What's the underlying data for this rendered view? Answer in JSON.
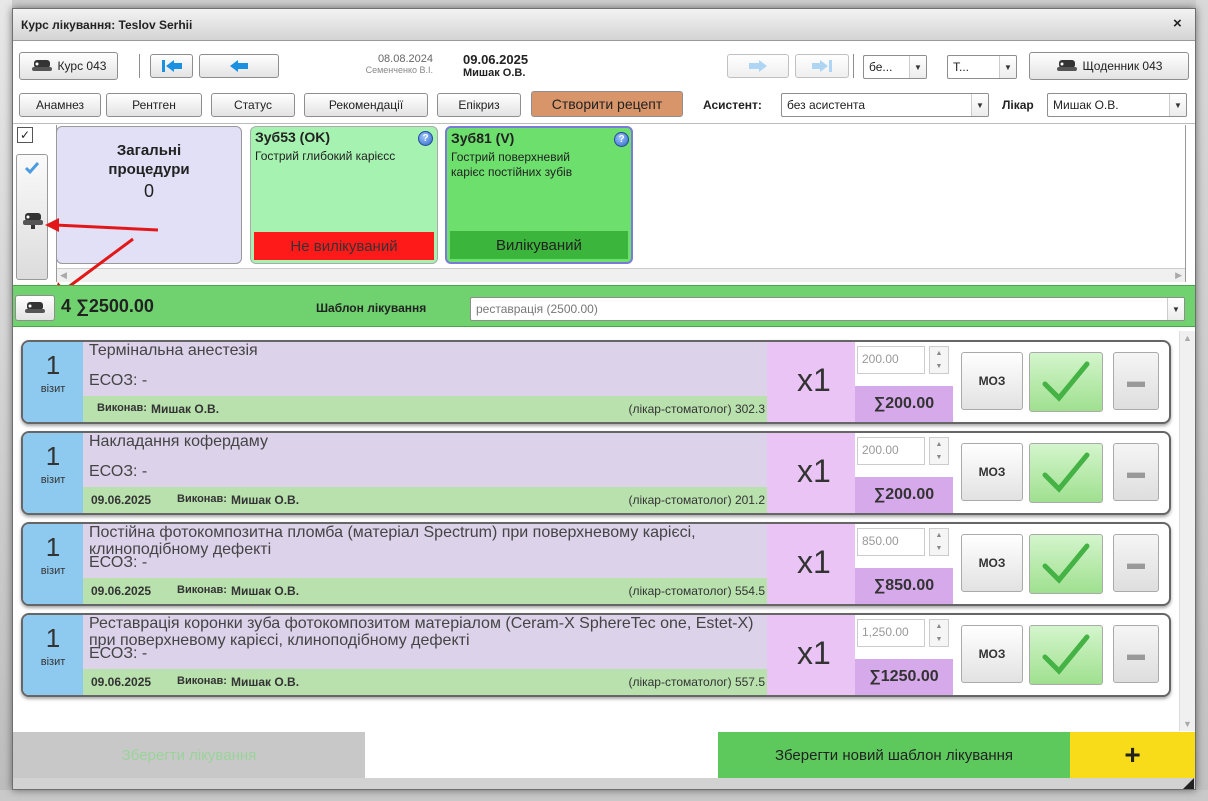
{
  "window": {
    "title": "Курс лікування: Teslov Serhii",
    "close": "×"
  },
  "toolbar": {
    "course_btn": "Курс 043",
    "prev_date": "08.08.2024",
    "prev_doctor": "Семенченко В.І.",
    "cur_date": "09.06.2025",
    "cur_doctor": "Мишак О.В.",
    "dd1": "бе...",
    "dd2": "Т...",
    "diary_btn": "Щоденник 043"
  },
  "nav": {
    "anamnez": "Анамнез",
    "rentgen": "Рентген",
    "status": "Статус",
    "recommend": "Рекомендації",
    "epicrisis": "Епікриз",
    "recipe": "Створити рецепт",
    "assistant_label": "Асистент:",
    "assistant_value": "без асистента",
    "doctor_label": "Лікар",
    "doctor_value": "Мишак О.В."
  },
  "general": {
    "title": "Загальні процедури",
    "count": "0"
  },
  "teeth": [
    {
      "title": "Зуб53 (OK)",
      "desc": "Гострий глибокий карієсс",
      "status": "Не вилікуваний",
      "color": "#a6f2b0",
      "status_color": "#ff1a1a"
    },
    {
      "title": "Зуб81 (V)",
      "desc": "Гострий поверхневий карієс постійних зубів",
      "status": "Вилікуваний",
      "color": "#6ddf6d",
      "status_color": "#3bb53b"
    }
  ],
  "summary": {
    "count_total": "4 ∑2500.00",
    "template_label": "Шаблон лікування",
    "template_value": "реставрація (2500.00)"
  },
  "procedures": [
    {
      "visit_num": "1",
      "visit_label": "візит",
      "name": "Термінальна анестезія",
      "eco": "ЕСОЗ: -",
      "date": "",
      "executor_label": "Виконав:",
      "executor": "Мишак О.В.",
      "doctor_info": "(лікар-стоматолог) 302.3",
      "qty": "x1",
      "price": "200.00",
      "sum": "∑200.00",
      "moz": "МОЗ"
    },
    {
      "visit_num": "1",
      "visit_label": "візит",
      "name": "Накладання кофердаму",
      "eco": "ЕСОЗ: -",
      "date": "09.06.2025",
      "executor_label": "Виконав:",
      "executor": "Мишак О.В.",
      "doctor_info": "(лікар-стоматолог) 201.2",
      "qty": "x1",
      "price": "200.00",
      "sum": "∑200.00",
      "moz": "МОЗ"
    },
    {
      "visit_num": "1",
      "visit_label": "візит",
      "name": "Постійна фотокомпозитна пломба (матеріал Spectrum) при поверхневому карієсі, клиноподібному дефекті",
      "eco": "ЕСОЗ: -",
      "date": "09.06.2025",
      "executor_label": "Виконав:",
      "executor": "Мишак О.В.",
      "doctor_info": "(лікар-стоматолог) 554.5",
      "qty": "x1",
      "price": "850.00",
      "sum": "∑850.00",
      "moz": "МОЗ"
    },
    {
      "visit_num": "1",
      "visit_label": "візит",
      "name": "Реставрація коронки зуба фотокомпозитом матеріалом (Ceram-X SphereTec one, Estet-X) при поверхневому карієсі, клиноподібному дефекті",
      "eco": "ЕСОЗ: -",
      "date": "09.06.2025",
      "executor_label": "Виконав:",
      "executor": "Мишак О.В.",
      "doctor_info": "(лікар-стоматолог) 557.5",
      "qty": "x1",
      "price": "1,250.00",
      "sum": "∑1250.00",
      "moz": "МОЗ"
    }
  ],
  "footer": {
    "save": "Зберегти лікування",
    "save_template": "Зберегти новий шаблон лікування",
    "add": "+"
  },
  "colors": {
    "green_bar": "#6fd26f",
    "visit_blue": "#8ec9ef",
    "name_purple": "#dcd2ea",
    "qty_purple": "#eac4f5",
    "yellow_add": "#f8dc1a"
  }
}
